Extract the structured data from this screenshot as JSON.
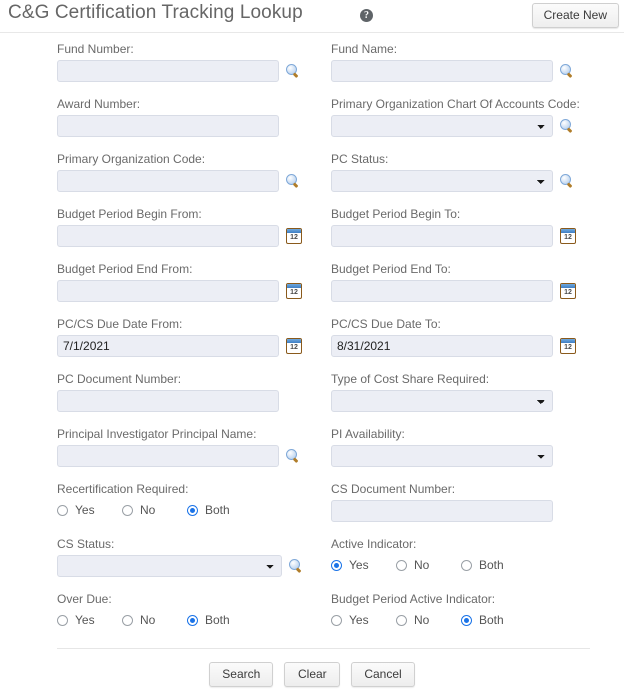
{
  "header": {
    "title": "C&G Certification Tracking Lookup",
    "help_icon": "help-circle-icon",
    "help_glyph": "?",
    "create_new_label": "Create New"
  },
  "fields": {
    "fund_number": {
      "label": "Fund Number:",
      "value": "",
      "placeholder": ""
    },
    "fund_name": {
      "label": "Fund Name:",
      "value": "",
      "placeholder": ""
    },
    "award_number": {
      "label": "Award Number:",
      "value": "",
      "placeholder": ""
    },
    "primary_org_coa_code": {
      "label": "Primary Organization Chart Of Accounts Code:",
      "value": ""
    },
    "primary_org_code": {
      "label": "Primary Organization Code:",
      "value": "",
      "placeholder": ""
    },
    "pc_status": {
      "label": "PC Status:",
      "value": ""
    },
    "budget_period_begin_from": {
      "label": "Budget Period Begin From:",
      "value": ""
    },
    "budget_period_begin_to": {
      "label": "Budget Period Begin To:",
      "value": ""
    },
    "budget_period_end_from": {
      "label": "Budget Period End From:",
      "value": ""
    },
    "budget_period_end_to": {
      "label": "Budget Period End To:",
      "value": ""
    },
    "pccs_due_date_from": {
      "label": "PC/CS Due Date From:",
      "value": "7/1/2021"
    },
    "pccs_due_date_to": {
      "label": "PC/CS Due Date To:",
      "value": "8/31/2021"
    },
    "pc_document_number": {
      "label": "PC Document Number:",
      "value": ""
    },
    "type_of_cost_share_required": {
      "label": "Type of Cost Share Required:",
      "value": ""
    },
    "principal_investigator_principal_name": {
      "label": "Principal Investigator Principal Name:",
      "value": ""
    },
    "pi_availability": {
      "label": "PI Availability:",
      "value": ""
    },
    "recertification_required": {
      "label": "Recertification Required:",
      "selected": "Both"
    },
    "cs_document_number": {
      "label": "CS Document Number:",
      "value": ""
    },
    "cs_status": {
      "label": "CS Status:",
      "value": ""
    },
    "active_indicator": {
      "label": "Active Indicator:",
      "selected": "Yes"
    },
    "over_due": {
      "label": "Over Due:",
      "selected": "Both"
    },
    "budget_period_active_indicator": {
      "label": "Budget Period Active Indicator:",
      "selected": "Both"
    }
  },
  "radio_options": {
    "yes": "Yes",
    "no": "No",
    "both": "Both"
  },
  "icons": {
    "lookup": "magnifier-icon",
    "calendar": "calendar-icon"
  },
  "footer": {
    "search_label": "Search",
    "clear_label": "Clear",
    "cancel_label": "Cancel"
  },
  "colors": {
    "field_background": "#eceef5",
    "field_border": "#d8dce6",
    "radio_accent": "#1a73e8",
    "title_text": "#666666",
    "label_text": "#6a6a6a",
    "calendar_border": "#8a5a1c"
  }
}
